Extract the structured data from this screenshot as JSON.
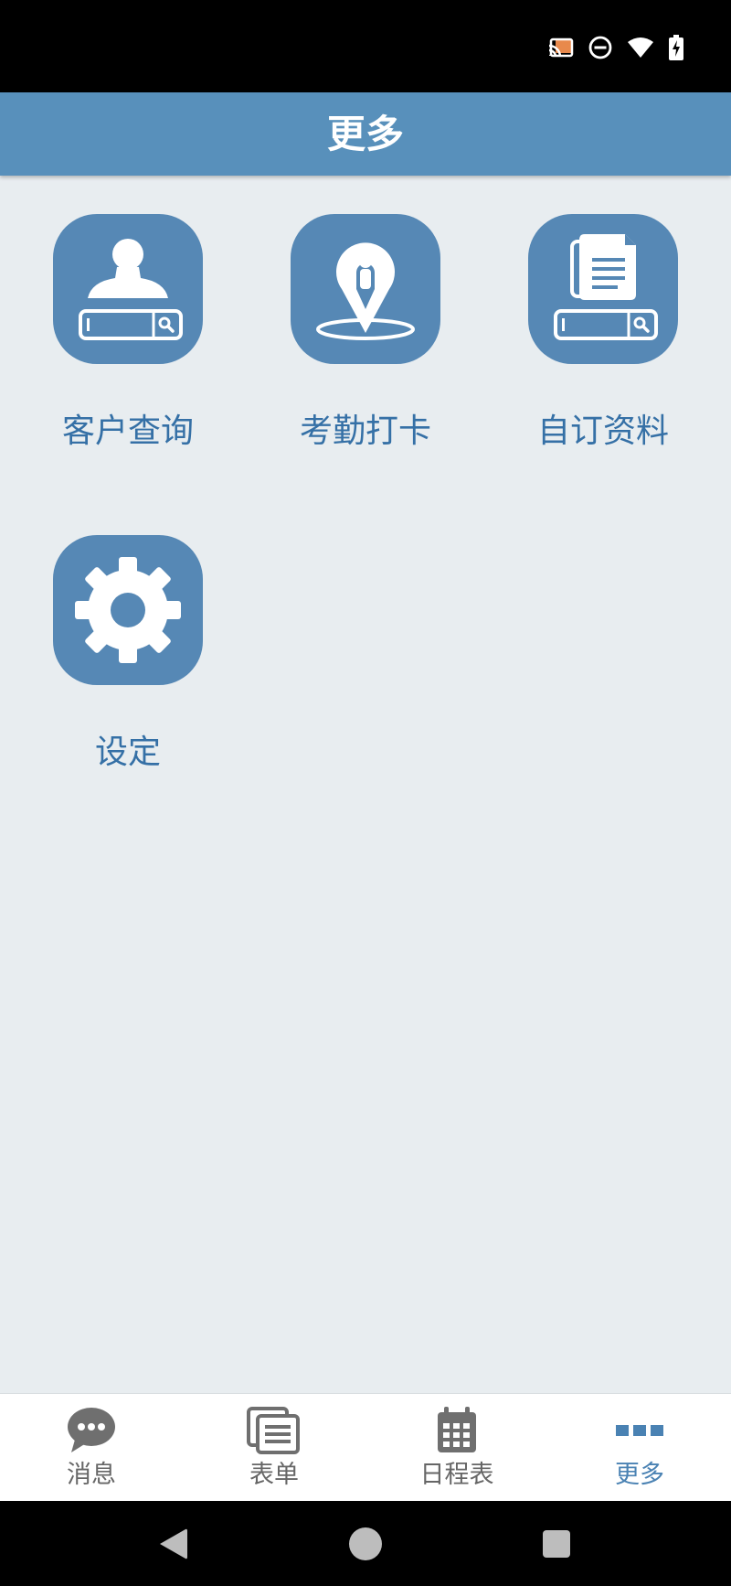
{
  "app_bar": {
    "title": "更多"
  },
  "tiles": [
    {
      "label": "客户查询",
      "icon": "customer-search-icon"
    },
    {
      "label": "考勤打卡",
      "icon": "location-pin-icon"
    },
    {
      "label": "自订资料",
      "icon": "document-search-icon"
    },
    {
      "label": "设定",
      "icon": "gear-icon"
    }
  ],
  "bottom_nav": [
    {
      "label": "消息",
      "icon": "chat-bubble-icon",
      "active": false
    },
    {
      "label": "表单",
      "icon": "form-icon",
      "active": false
    },
    {
      "label": "日程表",
      "icon": "calendar-icon",
      "active": false
    },
    {
      "label": "更多",
      "icon": "more-icon",
      "active": true
    }
  ],
  "colors": {
    "accent": "#5890bb",
    "tile_background": "#5688b5",
    "tile_label": "#3570a6",
    "page_background": "#e8edf0",
    "nav_active": "#4a82b3",
    "nav_inactive": "#666666",
    "cast_accent": "#e8894c"
  }
}
